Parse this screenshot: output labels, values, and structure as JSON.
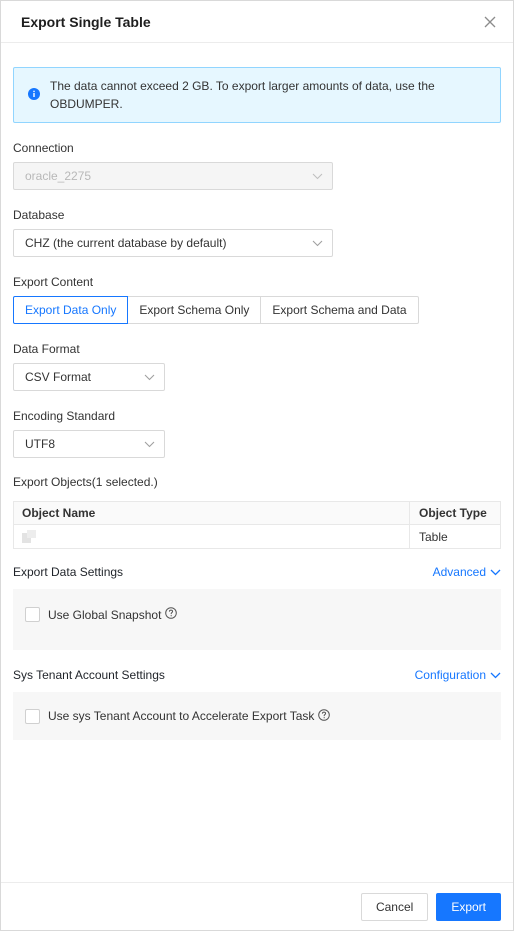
{
  "header": {
    "title": "Export Single Table",
    "close_icon": "close-icon"
  },
  "alert": {
    "text_line1": "The data cannot exceed 2 GB. To export larger amounts of data, use the",
    "text_line2": "OBDUMPER.",
    "icon": "info-icon",
    "color": "#1677ff"
  },
  "connection": {
    "label": "Connection",
    "value": "oracle_2275",
    "disabled": true
  },
  "database": {
    "label": "Database",
    "value": "CHZ (the current database by default)"
  },
  "export_content": {
    "label": "Export Content",
    "options": [
      "Export Data Only",
      "Export Schema Only",
      "Export Schema and Data"
    ],
    "selected": "Export Data Only"
  },
  "data_format": {
    "label": "Data Format",
    "value": "CSV Format"
  },
  "encoding": {
    "label": "Encoding Standard",
    "value": "UTF8"
  },
  "objects": {
    "label": "Export Objects(1 selected.)",
    "columns": [
      "Object Name",
      "Object Type"
    ],
    "rows": [
      {
        "name": "",
        "type": "Table"
      }
    ]
  },
  "export_data_settings": {
    "label": "Export Data Settings",
    "link": "Advanced",
    "checkbox_label": "Use Global Snapshot",
    "checked": false
  },
  "sys_tenant": {
    "label": "Sys Tenant Account Settings",
    "link": "Configuration",
    "checkbox_label": "Use sys Tenant Account to Accelerate Export Task",
    "checked": false
  },
  "footer": {
    "cancel_label": "Cancel",
    "export_label": "Export"
  },
  "colors": {
    "accent": "#1677ff",
    "alert_bg": "#e6f7ff",
    "alert_border": "#91d5ff"
  }
}
